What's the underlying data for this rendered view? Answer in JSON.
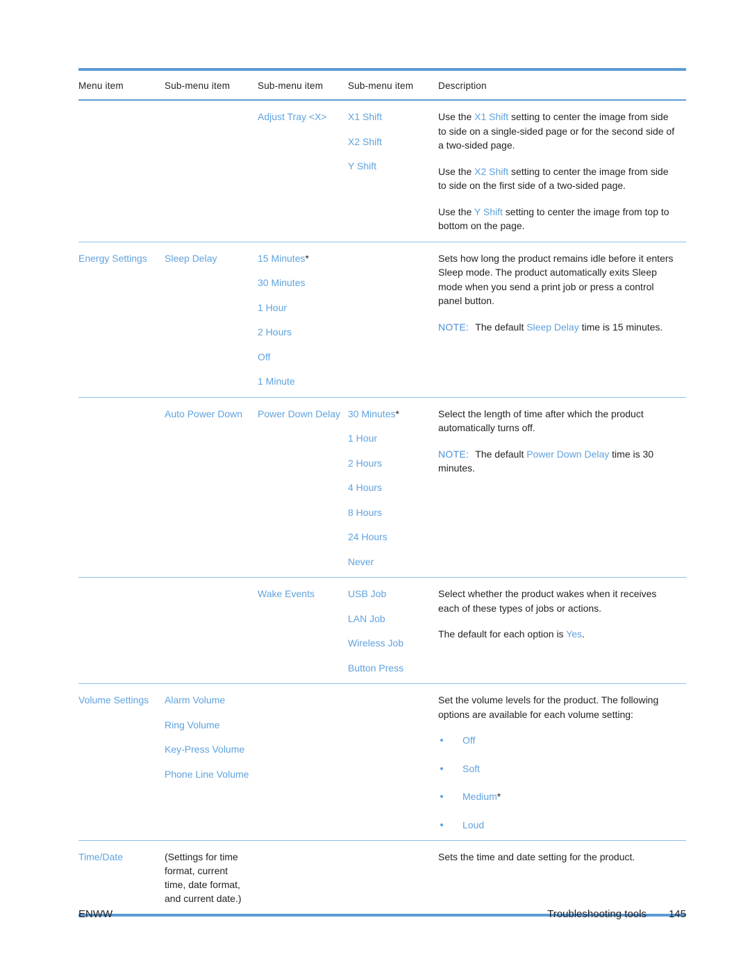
{
  "page": {
    "footer_left": "ENWW",
    "footer_section": "Troubleshooting tools",
    "footer_page": "145",
    "accent_color": "#5b9bd5",
    "link_color": "#5fa2dd",
    "text_color": "#231f20"
  },
  "table": {
    "headers": {
      "col0": "Menu item",
      "col1": "Sub-menu item",
      "col2": "Sub-menu item",
      "col3": "Sub-menu item",
      "col4": "Description"
    },
    "rows": [
      {
        "menu_item": "",
        "sub1": "",
        "sub2": "Adjust Tray <X>",
        "sub3_options": [
          {
            "label": "X1 Shift",
            "default": false
          },
          {
            "label": "X2 Shift",
            "default": false
          },
          {
            "label": "Y Shift",
            "default": false
          }
        ],
        "description": [
          {
            "parts": [
              {
                "t": "Use the ",
                "s": "plain"
              },
              {
                "t": "X1 Shift",
                "s": "link"
              },
              {
                "t": " setting to center the image from side to side on a single-sided page or for the second side of a two-sided page.",
                "s": "plain"
              }
            ]
          },
          {
            "parts": [
              {
                "t": "Use the ",
                "s": "plain"
              },
              {
                "t": "X2 Shift",
                "s": "link"
              },
              {
                "t": " setting to center the image from side to side on the first side of a two-sided page.",
                "s": "plain"
              }
            ]
          },
          {
            "parts": [
              {
                "t": "Use the ",
                "s": "plain"
              },
              {
                "t": "Y Shift",
                "s": "link"
              },
              {
                "t": " setting to center the image from top to bottom on the page.",
                "s": "plain"
              }
            ]
          }
        ]
      },
      {
        "menu_item": "Energy Settings",
        "sub1": "Sleep Delay",
        "sub2_options": [
          {
            "label": "15 Minutes",
            "default": true
          },
          {
            "label": "30 Minutes",
            "default": false
          },
          {
            "label": "1 Hour",
            "default": false
          },
          {
            "label": "2 Hours",
            "default": false
          },
          {
            "label": "Off",
            "default": false
          },
          {
            "label": "1 Minute",
            "default": false
          }
        ],
        "description": [
          {
            "parts": [
              {
                "t": "Sets how long the product remains idle before it enters Sleep mode. The product automatically exits Sleep mode when you send a print job or press a control panel button.",
                "s": "plain"
              }
            ]
          },
          {
            "note": true,
            "note_label": "NOTE:",
            "parts": [
              {
                "t": "The default ",
                "s": "plain"
              },
              {
                "t": "Sleep Delay",
                "s": "link"
              },
              {
                "t": " time is 15 minutes.",
                "s": "plain"
              }
            ]
          }
        ]
      },
      {
        "menu_item": "",
        "sub1": "Auto Power Down",
        "sub2": "Power Down Delay",
        "sub3_options": [
          {
            "label": "30 Minutes",
            "default": true
          },
          {
            "label": "1 Hour",
            "default": false
          },
          {
            "label": "2 Hours",
            "default": false
          },
          {
            "label": "4 Hours",
            "default": false
          },
          {
            "label": "8 Hours",
            "default": false
          },
          {
            "label": "24 Hours",
            "default": false
          },
          {
            "label": "Never",
            "default": false
          }
        ],
        "description": [
          {
            "parts": [
              {
                "t": "Select the length of time after which the product automatically turns off.",
                "s": "plain"
              }
            ]
          },
          {
            "note": true,
            "note_label": "NOTE:",
            "parts": [
              {
                "t": "The default ",
                "s": "plain"
              },
              {
                "t": "Power Down Delay",
                "s": "link"
              },
              {
                "t": " time is 30 minutes.",
                "s": "plain"
              }
            ]
          }
        ]
      },
      {
        "menu_item": "",
        "sub1": "",
        "sub2": "Wake Events",
        "sub3_options": [
          {
            "label": "USB Job",
            "default": false
          },
          {
            "label": "LAN Job",
            "default": false
          },
          {
            "label": "Wireless Job",
            "default": false
          },
          {
            "label": "Button Press",
            "default": false
          }
        ],
        "description": [
          {
            "parts": [
              {
                "t": "Select whether the product wakes when it receives each of these types of jobs or actions.",
                "s": "plain"
              }
            ]
          },
          {
            "parts": [
              {
                "t": "The default for each option is ",
                "s": "plain"
              },
              {
                "t": "Yes",
                "s": "link"
              },
              {
                "t": ".",
                "s": "plain"
              }
            ]
          }
        ]
      },
      {
        "menu_item": "Volume Settings",
        "sub1_options": [
          {
            "label": "Alarm Volume",
            "default": false
          },
          {
            "label": "Ring Volume",
            "default": false
          },
          {
            "label": "Key-Press Volume",
            "default": false
          },
          {
            "label": "Phone Line Volume",
            "default": false
          }
        ],
        "description": [
          {
            "parts": [
              {
                "t": "Set the volume levels for the product. The following options are available for each volume setting:",
                "s": "plain"
              }
            ]
          }
        ],
        "bullets": [
          {
            "label": "Off",
            "default": false
          },
          {
            "label": "Soft",
            "default": false
          },
          {
            "label": "Medium",
            "default": true
          },
          {
            "label": "Loud",
            "default": false
          }
        ]
      },
      {
        "menu_item": "Time/Date",
        "sub1_plain": "(Settings for time format, current time, date format, and current date.)",
        "description": [
          {
            "parts": [
              {
                "t": "Sets the time and date setting for the product.",
                "s": "plain"
              }
            ]
          }
        ]
      }
    ]
  }
}
